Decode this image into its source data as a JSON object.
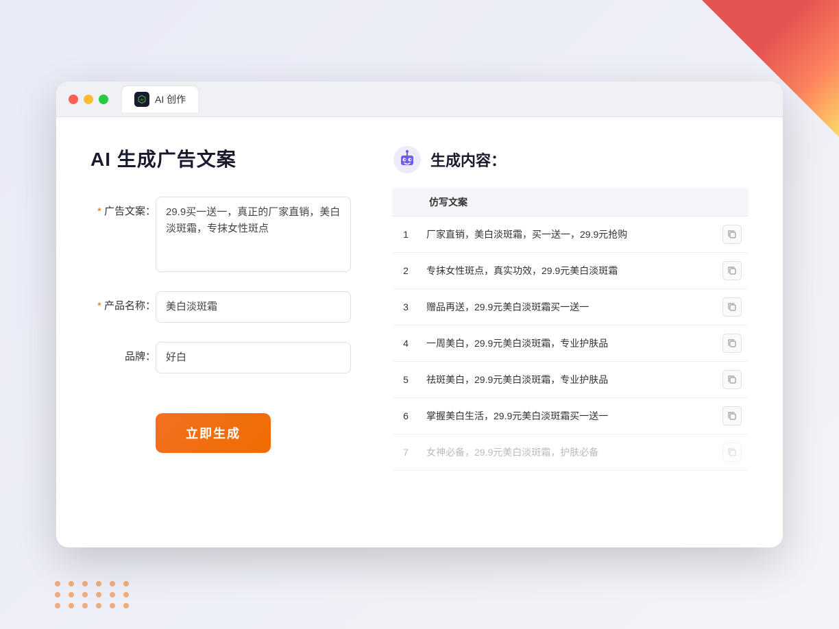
{
  "browser": {
    "tab_label": "AI 创作",
    "traffic_lights": [
      "red",
      "yellow",
      "green"
    ]
  },
  "left_panel": {
    "title": "AI 生成广告文案",
    "form": {
      "ad_copy_label": "广告文案：",
      "ad_copy_required": "*",
      "ad_copy_value": "29.9买一送一，真正的厂家直销，美白淡斑霜，专抹女性斑点",
      "product_label": "产品名称：",
      "product_required": "*",
      "product_value": "美白淡斑霜",
      "brand_label": "品牌：",
      "brand_value": "好白"
    },
    "generate_btn": "立即生成"
  },
  "right_panel": {
    "title": "生成内容：",
    "table_header": "仿写文案",
    "results": [
      {
        "num": 1,
        "text": "厂家直销，美白淡斑霜，买一送一，29.9元抢购"
      },
      {
        "num": 2,
        "text": "专抹女性斑点，真实功效，29.9元美白淡斑霜"
      },
      {
        "num": 3,
        "text": "赠品再送，29.9元美白淡斑霜买一送一"
      },
      {
        "num": 4,
        "text": "一周美白，29.9元美白淡斑霜，专业护肤品"
      },
      {
        "num": 5,
        "text": "祛斑美白，29.9元美白淡斑霜，专业护肤品"
      },
      {
        "num": 6,
        "text": "掌握美白生活，29.9元美白淡斑霜买一送一"
      },
      {
        "num": 7,
        "text": "女神必备，29.9元美白淡斑霜，护肤必备",
        "faded": true
      }
    ]
  }
}
